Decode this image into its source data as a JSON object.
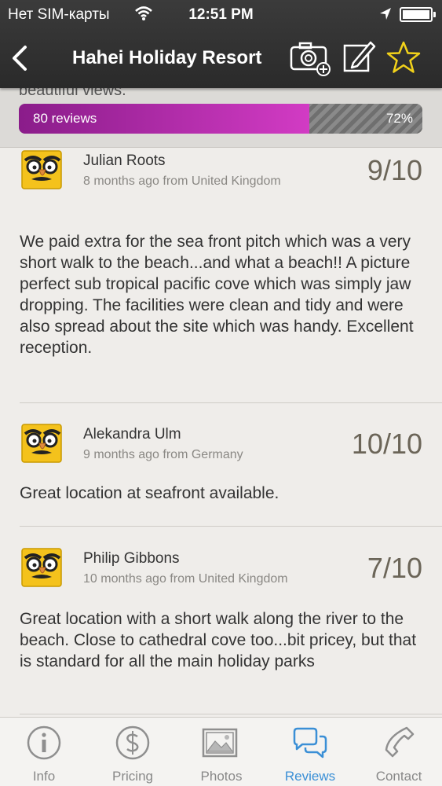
{
  "status_bar": {
    "carrier": "Нет SIM-карты",
    "time": "12:51 PM"
  },
  "nav": {
    "title": "Hahei Holiday Resort"
  },
  "rating_summary": {
    "cut_text": "beautiful views.",
    "reviews_label": "80 reviews",
    "percent_label": "72%",
    "percent_value": 72
  },
  "reviews": [
    {
      "name": "Julian Roots",
      "meta": "8 months ago from United Kingdom",
      "score": "9/10",
      "text": "We paid extra for the sea front pitch which was a very short walk to the beach...and what a beach!! A picture perfect sub tropical pacific cove which was simply jaw dropping. The facilities were clean and tidy and were also spread about the site which was handy. Excellent reception."
    },
    {
      "name": "Alekandra Ulm",
      "meta": "9 months ago from Germany",
      "score": "10/10",
      "text": "Great location at seafront available."
    },
    {
      "name": "Philip Gibbons",
      "meta": "10 months ago from United Kingdom",
      "score": "7/10",
      "text": "Great location with a short walk along the river to the beach. Close to cathedral cove too...bit pricey, but that is standard for all the main holiday parks"
    }
  ],
  "tabs": [
    {
      "label": "Info",
      "icon": "info-icon"
    },
    {
      "label": "Pricing",
      "icon": "dollar-icon"
    },
    {
      "label": "Photos",
      "icon": "photos-icon"
    },
    {
      "label": "Reviews",
      "icon": "chat-bubbles-icon",
      "active": true
    },
    {
      "label": "Contact",
      "icon": "phone-icon"
    }
  ],
  "colors": {
    "accent": "#3a8fd6",
    "bar_fill": "#b52eb0",
    "star": "#f2d21a"
  }
}
